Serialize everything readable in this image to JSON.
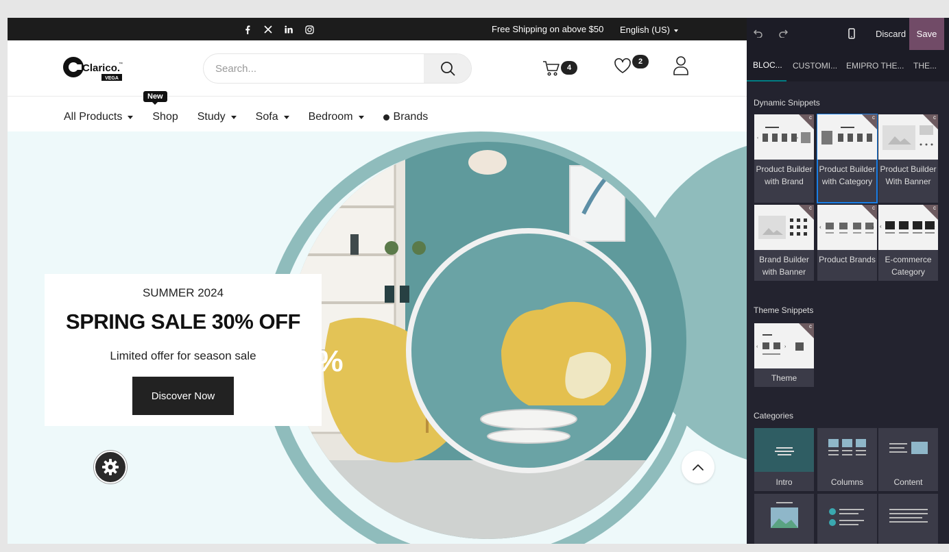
{
  "topbar": {
    "social": [
      "facebook-icon",
      "x-icon",
      "linkedin-icon",
      "instagram-icon"
    ],
    "shipping_text": "Free Shipping on above $50",
    "language": "English (US)"
  },
  "header": {
    "logo_text": "Clarico.",
    "logo_tm": "™",
    "logo_sub": "VEGA",
    "search_placeholder": "Search...",
    "cart_count": "4",
    "wishlist_count": "2"
  },
  "nav": {
    "new_badge": "New",
    "items": [
      {
        "label": "All Products",
        "dropdown": true
      },
      {
        "label": "Shop",
        "dropdown": false
      },
      {
        "label": "Study",
        "dropdown": true
      },
      {
        "label": "Sofa",
        "dropdown": true
      },
      {
        "label": "Bedroom",
        "dropdown": true
      },
      {
        "label": "Brands",
        "dropdown": false
      }
    ]
  },
  "hero": {
    "kicker": "SUMMER 2024",
    "title": "SPRING SALE 30% OFF",
    "subtitle": "Limited offer for season sale",
    "button": "Discover Now",
    "decor_text": "%"
  },
  "panel": {
    "discard": "Discard",
    "save": "Save",
    "tabs": [
      "BLOC...",
      "CUSTOMI...",
      "EMIPRO THE...",
      "THE..."
    ],
    "dynamic_title": "Dynamic Snippets",
    "dynamic": [
      {
        "label": "Product Builder with Brand"
      },
      {
        "label": "Product Builder with Category"
      },
      {
        "label": "Product Builder With Banner"
      },
      {
        "label": "Brand Builder with Banner"
      },
      {
        "label": "Product Brands"
      },
      {
        "label": "E-commerce Category"
      }
    ],
    "theme_title": "Theme Snippets",
    "theme": [
      {
        "label": "Theme"
      }
    ],
    "categories_title": "Categories",
    "categories": [
      {
        "label": "Intro"
      },
      {
        "label": "Columns"
      },
      {
        "label": "Content"
      },
      {
        "label": ""
      },
      {
        "label": ""
      },
      {
        "label": ""
      }
    ]
  },
  "colors": {
    "topbar": "#1c1c1c",
    "hero_bg": "#eef9fa",
    "teal": "#8fbcbc",
    "panel_bg": "#23232f",
    "save_btn": "#714b67",
    "selected_outline": "#1a7fe6"
  }
}
